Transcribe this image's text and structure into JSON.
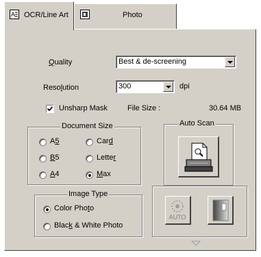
{
  "tabs": [
    {
      "label": "OCR/Line Art",
      "icon": "text-document-icon"
    },
    {
      "label": "Photo",
      "icon": "photo-icon"
    }
  ],
  "quality": {
    "label": "Quality",
    "value": "Best & de-screening"
  },
  "resolution": {
    "label": "Resolution",
    "value": "300",
    "unit": "dpi"
  },
  "unsharp": {
    "label": "Unsharp Mask",
    "checked": true
  },
  "filesize": {
    "label": "File Size :",
    "value": "30.64 MB"
  },
  "docsize": {
    "title": "Document Size",
    "options": [
      "A5",
      "Card",
      "B5",
      "Letter",
      "A4",
      "Max"
    ],
    "selected": "Max"
  },
  "autoscan": {
    "title": "Auto Scan"
  },
  "imagetype": {
    "title": "Image Type",
    "options": [
      "Color Photo",
      "Black & White Photo"
    ],
    "selected": "Color Photo"
  },
  "auto_label": "AUTO"
}
